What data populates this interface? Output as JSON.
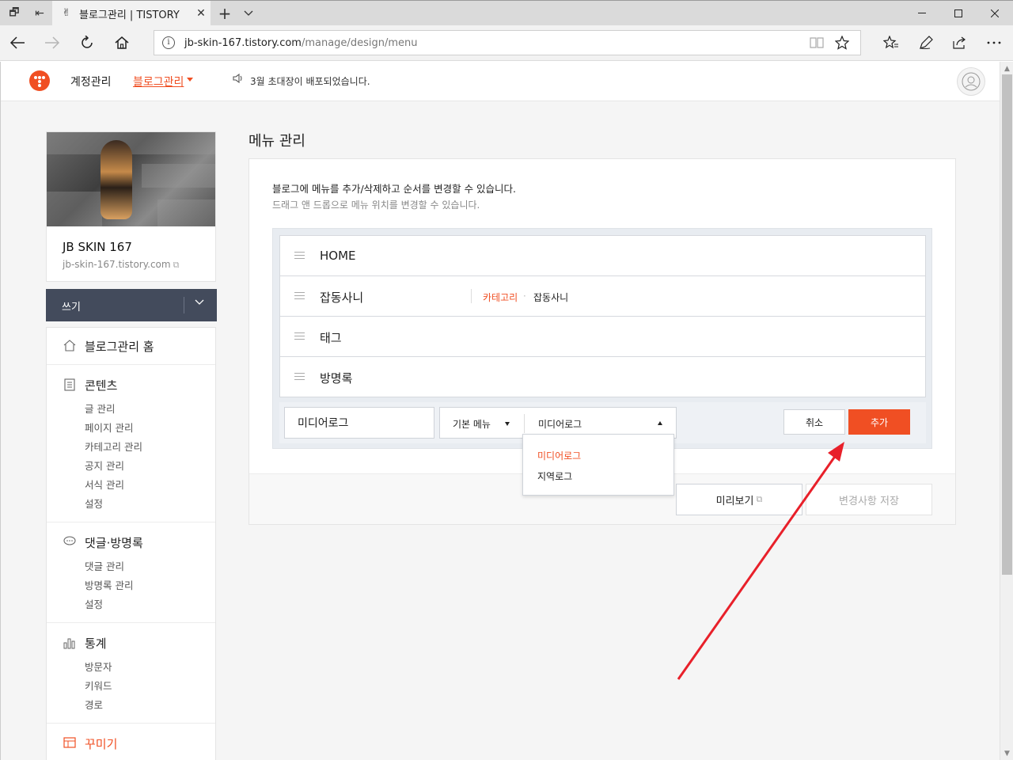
{
  "browser": {
    "tab_title": "블로그관리 | TISTORY",
    "url_host": "jb-skin-167.tistory.com",
    "url_path": "/manage/design/menu"
  },
  "header": {
    "account": "계정관리",
    "blog_manage": "블로그관리",
    "notice": "3월 초대장이 배포되었습니다.",
    "brand_color": "#f04f23"
  },
  "profile": {
    "blog_name": "JB SKIN 167",
    "blog_url": "jb-skin-167.tistory.com"
  },
  "sidebar": {
    "write": "쓰기",
    "home": "블로그관리 홈",
    "contents": {
      "title": "콘텐츠",
      "items": [
        "글 관리",
        "페이지 관리",
        "카테고리 관리",
        "공지 관리",
        "서식 관리",
        "설정"
      ]
    },
    "comments": {
      "title": "댓글·방명록",
      "items": [
        "댓글 관리",
        "방명록 관리",
        "설정"
      ]
    },
    "stats": {
      "title": "통계",
      "items": [
        "방문자",
        "키워드",
        "경로"
      ]
    },
    "decorate": {
      "title": "꾸미기"
    }
  },
  "main": {
    "title": "메뉴 관리",
    "desc1": "블로그에 메뉴를 추가/삭제하고 순서를 변경할 수 있습니다.",
    "desc2": "드래그 앤 드롭으로 메뉴 위치를 변경할 수 있습니다.",
    "menus": [
      {
        "label": "HOME",
        "type": "",
        "target": ""
      },
      {
        "label": "잡동사니",
        "type": "카테고리",
        "target": "잡동사니"
      },
      {
        "label": "태그",
        "type": "",
        "target": ""
      },
      {
        "label": "방명록",
        "type": "",
        "target": ""
      }
    ],
    "add_form": {
      "name_value": "미디어로그",
      "type_main": "기본 메뉴",
      "type_sub": "미디어로그",
      "cancel": "취소",
      "add": "추가",
      "options": [
        "미디어로그",
        "지역로그"
      ]
    },
    "preview": "미리보기",
    "save": "변경사항 저장"
  }
}
